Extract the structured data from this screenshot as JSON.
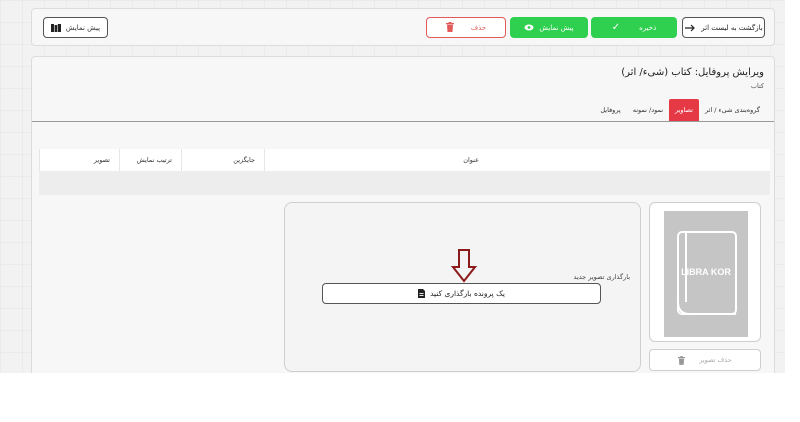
{
  "toolbar": {
    "back_label": "بازگشت به لیست اثر",
    "save_label": "ذخیره",
    "preview_label": "پیش نمایش",
    "delete_label": "حذف",
    "preview_outline_label": "پیش نمایش"
  },
  "page": {
    "title": "ویرایش پروفایل: کتاب (شیء/ اثر)",
    "subtitle": "کتاب"
  },
  "tabs": [
    {
      "label": "پروفایل",
      "active": false
    },
    {
      "label": "نمود/ نمونه",
      "active": false
    },
    {
      "label": "تصاویر",
      "active": true
    },
    {
      "label": "گروه‌بندی شیء / اثر",
      "active": false
    }
  ],
  "table": {
    "headers": [
      "تصویر",
      "ترتیب نمایش",
      "جایگزین",
      "عنوان",
      ""
    ]
  },
  "image_card": {
    "logo_text": "LIBRA KOR",
    "delete_label": "حذف تصویر"
  },
  "upload": {
    "label": "بارگذاری تصویر جدید",
    "button_label": "یک پرونده بارگذاری کنید"
  },
  "icons": {
    "back": "arrow-right-icon",
    "save": "check-icon",
    "preview": "eye-icon",
    "delete": "trash-icon",
    "preview_outline": "book-icon",
    "upload": "file-icon",
    "annotation": "down-arrow-icon"
  },
  "colors": {
    "green": "#2fcf4f",
    "red": "#e53945",
    "annotation": "#8b1a1a"
  }
}
